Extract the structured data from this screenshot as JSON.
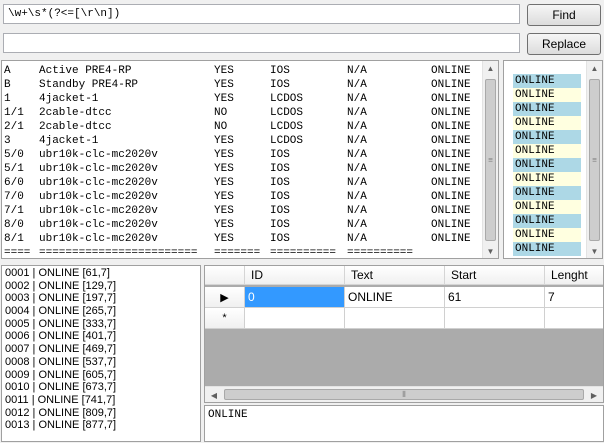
{
  "search": {
    "value": "\\w+\\s*(?<=[\\r\\n])",
    "button_label": "Find"
  },
  "replace": {
    "value": "",
    "button_label": "Replace"
  },
  "text_rows": [
    [
      "A",
      "Active PRE4-RP",
      "YES",
      "IOS",
      "N/A",
      "ONLINE"
    ],
    [
      "B",
      "Standby PRE4-RP",
      "YES",
      "IOS",
      "N/A",
      "ONLINE"
    ],
    [
      "1",
      "4jacket-1",
      "YES",
      "LCDOS",
      "N/A",
      "ONLINE"
    ],
    [
      "1/1",
      "2cable-dtcc",
      "NO",
      "LCDOS",
      "N/A",
      "ONLINE"
    ],
    [
      "2/1",
      "2cable-dtcc",
      "NO",
      "LCDOS",
      "N/A",
      "ONLINE"
    ],
    [
      "3",
      "4jacket-1",
      "YES",
      "LCDOS",
      "N/A",
      "ONLINE"
    ],
    [
      "5/0",
      "ubr10k-clc-mc2020v",
      "YES",
      "IOS",
      "N/A",
      "ONLINE"
    ],
    [
      "5/1",
      "ubr10k-clc-mc2020v",
      "YES",
      "IOS",
      "N/A",
      "ONLINE"
    ],
    [
      "6/0",
      "ubr10k-clc-mc2020v",
      "YES",
      "IOS",
      "N/A",
      "ONLINE"
    ],
    [
      "7/0",
      "ubr10k-clc-mc2020v",
      "YES",
      "IOS",
      "N/A",
      "ONLINE"
    ],
    [
      "7/1",
      "ubr10k-clc-mc2020v",
      "YES",
      "IOS",
      "N/A",
      "ONLINE"
    ],
    [
      "8/0",
      "ubr10k-clc-mc2020v",
      "YES",
      "IOS",
      "N/A",
      "ONLINE"
    ],
    [
      "8/1",
      "ubr10k-clc-mc2020v",
      "YES",
      "IOS",
      "N/A",
      "ONLINE"
    ]
  ],
  "separator_row": [
    "====",
    "========================",
    "=======",
    "==========",
    "==========",
    ""
  ],
  "highlight_rows": [
    "ONLINE",
    "ONLINE",
    "ONLINE",
    "ONLINE",
    "ONLINE",
    "ONLINE",
    "ONLINE",
    "ONLINE",
    "ONLINE",
    "ONLINE",
    "ONLINE",
    "ONLINE",
    "ONLINE"
  ],
  "highlight_colors": [
    "#add8e6",
    "#ffffe0"
  ],
  "match_list": [
    "0001 | ONLINE [61,7]",
    "0002 | ONLINE [129,7]",
    "0003 | ONLINE [197,7]",
    "0004 | ONLINE [265,7]",
    "0005 | ONLINE [333,7]",
    "0006 | ONLINE [401,7]",
    "0007 | ONLINE [469,7]",
    "0008 | ONLINE [537,7]",
    "0009 | ONLINE [605,7]",
    "0010 | ONLINE [673,7]",
    "0011 | ONLINE [741,7]",
    "0012 | ONLINE [809,7]",
    "0013 | ONLINE [877,7]"
  ],
  "grid": {
    "columns": [
      "ID",
      "Text",
      "Start",
      "Lenght"
    ],
    "rows": [
      {
        "cells": [
          "0",
          "ONLINE",
          "61",
          "7"
        ]
      }
    ],
    "new_row_marker": "*",
    "current_row_marker": "▶"
  },
  "preview_text": "ONLINE",
  "selection_color": "#3399ff"
}
